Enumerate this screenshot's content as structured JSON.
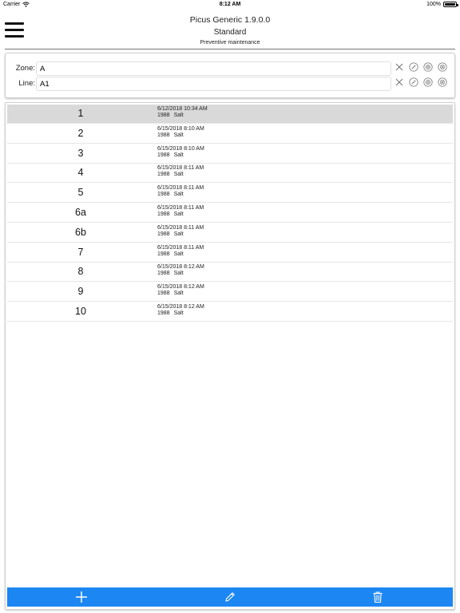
{
  "status_bar": {
    "carrier": "Carrier",
    "time": "8:12 AM",
    "battery": "100%"
  },
  "header": {
    "title": "Picus Generic 1.9.0.0",
    "subtitle": "Standard",
    "caption": "Preventive maintenance"
  },
  "filters": {
    "zone": {
      "label": "Zone:",
      "value": "A"
    },
    "line": {
      "label": "Line:",
      "value": "A1"
    }
  },
  "list": [
    {
      "number": "1",
      "date": "6/12/2018 10:34 AM",
      "code": "1988",
      "type": "Salt",
      "selected": true
    },
    {
      "number": "2",
      "date": "6/15/2018 8:10 AM",
      "code": "1988",
      "type": "Salt"
    },
    {
      "number": "3",
      "date": "6/15/2018 8:10 AM",
      "code": "1988",
      "type": "Salt"
    },
    {
      "number": "4",
      "date": "6/15/2018 8:11 AM",
      "code": "1988",
      "type": "Salt"
    },
    {
      "number": "5",
      "date": "6/15/2018 8:11 AM",
      "code": "1988",
      "type": "Salt"
    },
    {
      "number": "6a",
      "date": "6/15/2018 8:11 AM",
      "code": "1988",
      "type": "Salt"
    },
    {
      "number": "6b",
      "date": "6/15/2018 8:11 AM",
      "code": "1988",
      "type": "Salt"
    },
    {
      "number": "7",
      "date": "6/15/2018 8:11 AM",
      "code": "1988",
      "type": "Salt"
    },
    {
      "number": "8",
      "date": "6/15/2018 8:12 AM",
      "code": "1988",
      "type": "Salt"
    },
    {
      "number": "9",
      "date": "6/15/2018 8:12 AM",
      "code": "1988",
      "type": "Salt"
    },
    {
      "number": "10",
      "date": "6/15/2018 8:12 AM",
      "code": "1988",
      "type": "Salt"
    }
  ],
  "icons": {
    "menu": "hamburger-icon",
    "wifi": "wifi-icon",
    "battery": "battery-icon",
    "clear": "close-icon",
    "edit": "edit-circle-icon",
    "add": "add-circle-icon",
    "remove": "remove-circle-icon",
    "toolbar_add": "plus-icon",
    "toolbar_edit": "pencil-icon",
    "toolbar_delete": "trash-icon"
  },
  "colors": {
    "toolbar": "#1c86f2",
    "selected_row": "#d9d9d9",
    "icon_gray": "#888888"
  }
}
